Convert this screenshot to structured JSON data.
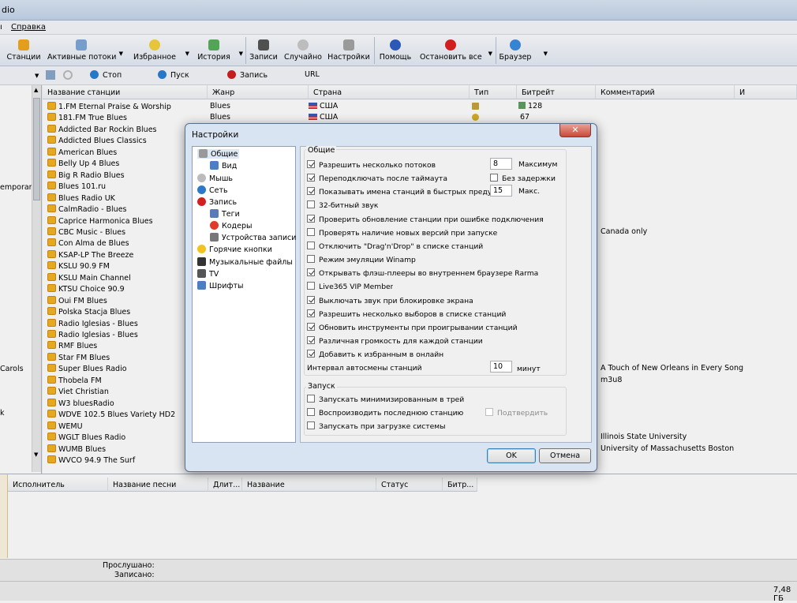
{
  "window": {
    "title": "dio"
  },
  "menu": {
    "items": [
      "Справка"
    ]
  },
  "toolbar": {
    "buttons": [
      "Станции",
      "Активные потоки",
      "Избранное",
      "История",
      "Записи",
      "Случайно",
      "Настройки",
      "Помощь",
      "Остановить все",
      "Браузер"
    ]
  },
  "controls": {
    "stop": "Стоп",
    "play": "Пуск",
    "record": "Запись",
    "url_label": "URL"
  },
  "left_pane": {
    "items": [
      "emporary",
      "Carols",
      "k"
    ]
  },
  "stations": {
    "headers": [
      "Название станции",
      "Жанр",
      "Страна",
      "Тип",
      "Битрейт",
      "Комментарий",
      "И"
    ],
    "rows": [
      {
        "name": "1.FM Eternal Praise & Worship",
        "genre": "Blues",
        "country": "США",
        "bitrate": "128",
        "comment": ""
      },
      {
        "name": "181.FM True Blues",
        "genre": "Blues",
        "country": "США",
        "bitrate": "67",
        "comment": ""
      },
      {
        "name": "Addicted Bar Rockin Blues",
        "genre": "",
        "country": "",
        "bitrate": "",
        "comment": ""
      },
      {
        "name": "Addicted Blues Classics",
        "genre": "",
        "country": "",
        "bitrate": "",
        "comment": ""
      },
      {
        "name": "American Blues",
        "genre": "",
        "country": "",
        "bitrate": "",
        "comment": ""
      },
      {
        "name": "Belly Up 4 Blues",
        "genre": "",
        "country": "",
        "bitrate": "",
        "comment": ""
      },
      {
        "name": "Big R Radio Blues",
        "genre": "",
        "country": "",
        "bitrate": "",
        "comment": ""
      },
      {
        "name": "Blues 101.ru",
        "genre": "",
        "country": "",
        "bitrate": "",
        "comment": ""
      },
      {
        "name": "Blues Radio UK",
        "genre": "",
        "country": "",
        "bitrate": "",
        "comment": ""
      },
      {
        "name": "CalmRadio - Blues",
        "genre": "",
        "country": "",
        "bitrate": "",
        "comment": ""
      },
      {
        "name": "Caprice Harmonica Blues",
        "genre": "",
        "country": "",
        "bitrate": "",
        "comment": ""
      },
      {
        "name": "CBC Music - Blues",
        "genre": "",
        "country": "",
        "bitrate": "",
        "comment": "Canada only"
      },
      {
        "name": "Con Alma de Blues",
        "genre": "",
        "country": "",
        "bitrate": "",
        "comment": ""
      },
      {
        "name": "KSAP-LP The Breeze",
        "genre": "",
        "country": "",
        "bitrate": "",
        "comment": ""
      },
      {
        "name": "KSLU 90.9 FM",
        "genre": "",
        "country": "",
        "bitrate": "",
        "comment": ""
      },
      {
        "name": "KSLU Main Channel",
        "genre": "",
        "country": "",
        "bitrate": "",
        "comment": ""
      },
      {
        "name": "KTSU Choice 90.9",
        "genre": "",
        "country": "",
        "bitrate": "",
        "comment": ""
      },
      {
        "name": "Oui FM Blues",
        "genre": "",
        "country": "",
        "bitrate": "",
        "comment": ""
      },
      {
        "name": "Polska Stacja Blues",
        "genre": "",
        "country": "",
        "bitrate": "",
        "comment": ""
      },
      {
        "name": "Radio Iglesias - Blues",
        "genre": "",
        "country": "",
        "bitrate": "",
        "comment": ""
      },
      {
        "name": "Radio Iglesias - Blues",
        "genre": "",
        "country": "",
        "bitrate": "",
        "comment": ""
      },
      {
        "name": "RMF Blues",
        "genre": "",
        "country": "",
        "bitrate": "",
        "comment": ""
      },
      {
        "name": "Star FM Blues",
        "genre": "",
        "country": "",
        "bitrate": "",
        "comment": ""
      },
      {
        "name": "Super Blues Radio",
        "genre": "",
        "country": "",
        "bitrate": "",
        "comment": "A Touch of New Orleans in Every Song"
      },
      {
        "name": "Thobela FM",
        "genre": "",
        "country": "",
        "bitrate": "",
        "comment": "m3u8"
      },
      {
        "name": "Viet Christian",
        "genre": "",
        "country": "",
        "bitrate": "",
        "comment": ""
      },
      {
        "name": "W3 bluesRadio",
        "genre": "",
        "country": "",
        "bitrate": "",
        "comment": ""
      },
      {
        "name": "WDVE 102.5 Blues Variety HD2",
        "genre": "",
        "country": "",
        "bitrate": "",
        "comment": ""
      },
      {
        "name": "WEMU",
        "genre": "",
        "country": "",
        "bitrate": "",
        "comment": ""
      },
      {
        "name": "WGLT Blues Radio",
        "genre": "",
        "country": "",
        "bitrate": "",
        "comment": "Illinois State University"
      },
      {
        "name": "WUMB Blues",
        "genre": "",
        "country": "",
        "bitrate": "",
        "comment": "University of Massachusetts Boston"
      },
      {
        "name": "WVCO 94.9 The Surf",
        "genre": "",
        "country": "",
        "bitrate": "",
        "comment": ""
      }
    ]
  },
  "records": {
    "headers": [
      "Исполнитель",
      "Название песни",
      "Длит...",
      "Название",
      "Статус",
      "Битр..."
    ]
  },
  "status": {
    "listened_label": "Прослушано:",
    "recorded_label": "Записано:",
    "disk_free": "7,48 ГБ"
  },
  "dialog": {
    "title": "Настройки",
    "close": "✕",
    "tree": [
      {
        "label": "Общие",
        "icon": "wrench-icon"
      },
      {
        "label": "Вид",
        "icon": "window-icon"
      },
      {
        "label": "Мышь",
        "icon": "mouse-icon"
      },
      {
        "label": "Сеть",
        "icon": "globe-icon"
      },
      {
        "label": "Запись",
        "icon": "record-icon"
      },
      {
        "label": "Теги",
        "icon": "tag-icon"
      },
      {
        "label": "Кодеры",
        "icon": "encoder-icon"
      },
      {
        "label": "Устройства записи",
        "icon": "device-icon"
      },
      {
        "label": "Горячие кнопки",
        "icon": "hotkey-icon"
      },
      {
        "label": "Музыкальные файлы",
        "icon": "music-icon"
      },
      {
        "label": "TV",
        "icon": "tv-icon"
      },
      {
        "label": "Шрифты",
        "icon": "font-icon"
      }
    ],
    "general": {
      "title": "Общие",
      "options": [
        {
          "label": "Разрешить несколько потоков",
          "checked": true
        },
        {
          "label": "Переподключать после таймаута",
          "checked": true
        },
        {
          "label": "Показывать имена станций в быстрых предуста",
          "checked": true
        },
        {
          "label": "32-битный звук",
          "checked": false
        },
        {
          "label": "Проверить обновление станции при ошибке подключения",
          "checked": true
        },
        {
          "label": "Проверять наличие новых версий при запуске",
          "checked": false
        },
        {
          "label": "Отключить \"Drag'n'Drop\" в списке станций",
          "checked": false
        },
        {
          "label": "Режим эмуляции Winamp",
          "checked": false
        },
        {
          "label": "Открывать флэш-плееры во внутреннем браузере Rarma",
          "checked": true
        },
        {
          "label": "Live365 VIP Member",
          "checked": false
        },
        {
          "label": "Выключать звук при блокировке экрана",
          "checked": true
        },
        {
          "label": "Разрешить несколько выборов в списке станций",
          "checked": true
        },
        {
          "label": "Обновить инструменты при проигрывании станций",
          "checked": true
        },
        {
          "label": "Различная громкость для каждой станции",
          "checked": true
        },
        {
          "label": "Добавить к избранным в онлайн",
          "checked": true
        }
      ],
      "max_streams": "8",
      "max_label": "Максимум",
      "no_delay": "Без задержки",
      "max_names": "15",
      "max_names_label": "Макс.",
      "interval_label": "Интервал автосмены станций",
      "interval_value": "10",
      "interval_unit": "минут"
    },
    "startup": {
      "title": "Запуск",
      "options": [
        {
          "label": "Запускать минимизированным в трей",
          "checked": false
        },
        {
          "label": "Воспроизводить последнюю станцию",
          "checked": false
        },
        {
          "label": "Запускать при загрузке системы",
          "checked": false
        }
      ],
      "confirm": "Подтвердить"
    },
    "ok": "OK",
    "cancel": "Отмена"
  }
}
